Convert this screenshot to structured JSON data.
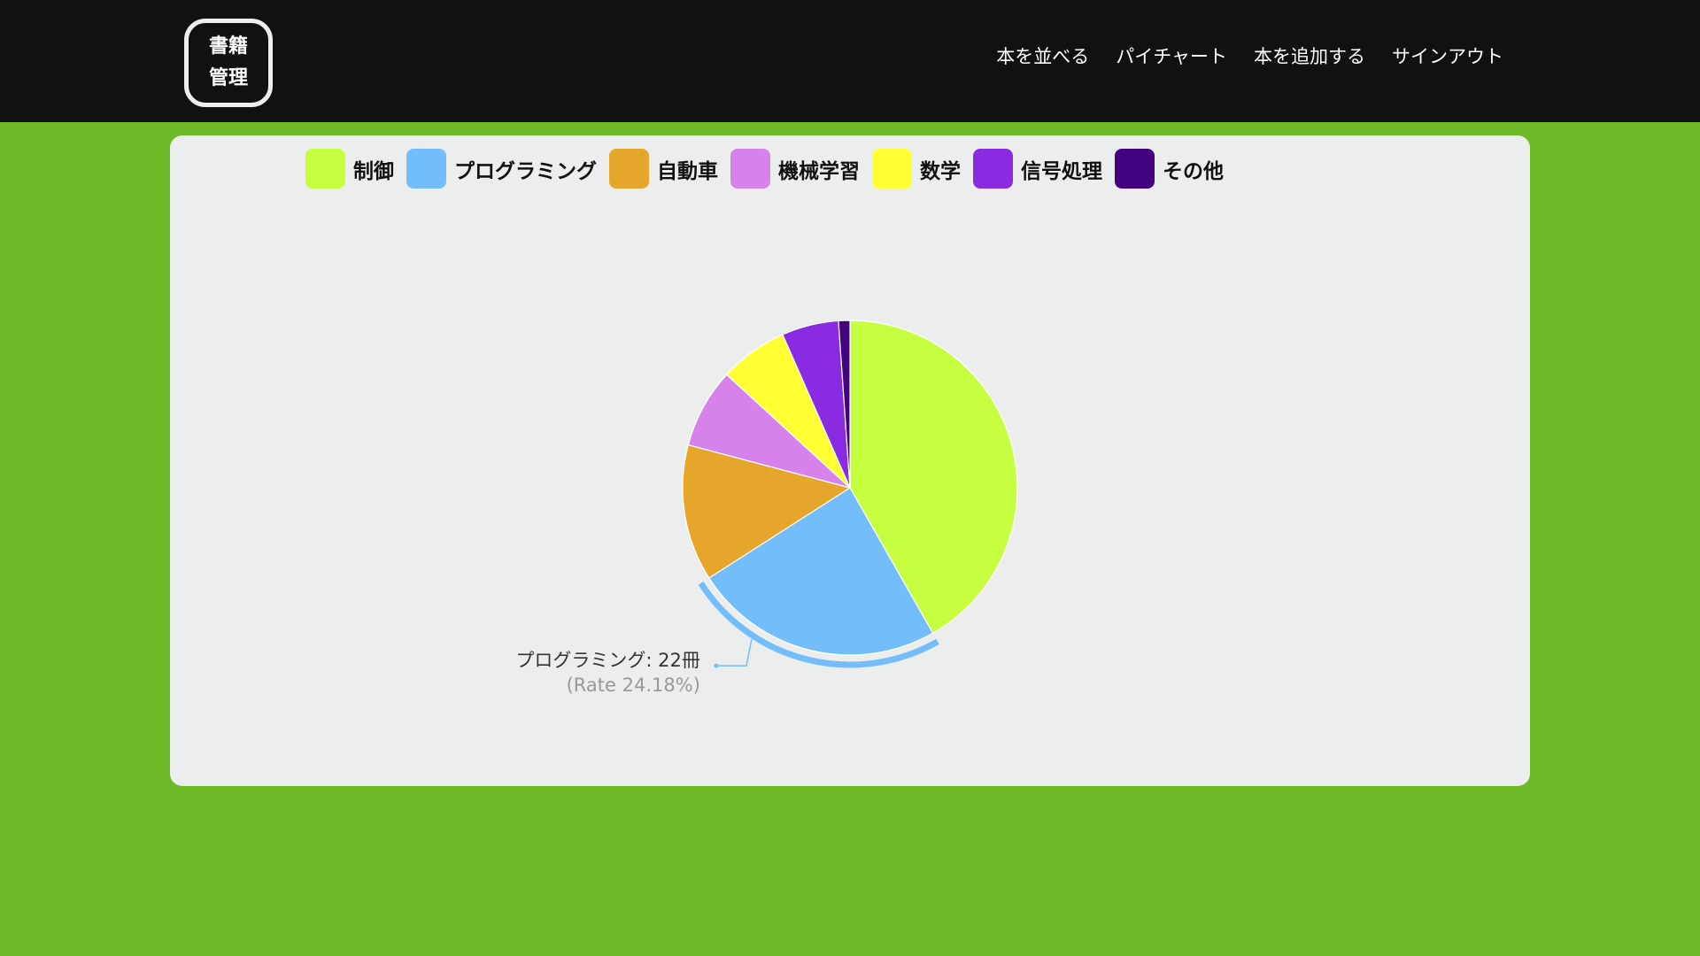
{
  "header": {
    "logo_line1": "書籍",
    "logo_line2": "管理",
    "nav": [
      {
        "label": "本を並べる"
      },
      {
        "label": "パイチャート"
      },
      {
        "label": "本を追加する"
      },
      {
        "label": "サインアウト"
      }
    ]
  },
  "colors": {
    "header_bg": "#111111",
    "page_bg": "#6fba28",
    "card_bg": "#eceded"
  },
  "chart_data": {
    "type": "pie",
    "unit": "冊",
    "total": 91,
    "series": [
      {
        "name": "制御",
        "value": 38,
        "color": "#c6ff3f"
      },
      {
        "name": "プログラミング",
        "value": 22,
        "color": "#74bdfb"
      },
      {
        "name": "自動車",
        "value": 12,
        "color": "#e6a62b"
      },
      {
        "name": "機械学習",
        "value": 7,
        "color": "#d782eb"
      },
      {
        "name": "数学",
        "value": 6,
        "color": "#ffff33"
      },
      {
        "name": "信号処理",
        "value": 5,
        "color": "#8a2be2"
      },
      {
        "name": "その他",
        "value": 1,
        "color": "#43037f"
      }
    ],
    "legend_position": "top",
    "tooltip": {
      "series_index": 1,
      "line1": "プログラミング: 22冊",
      "line2": "(Rate 24.18%)"
    }
  }
}
